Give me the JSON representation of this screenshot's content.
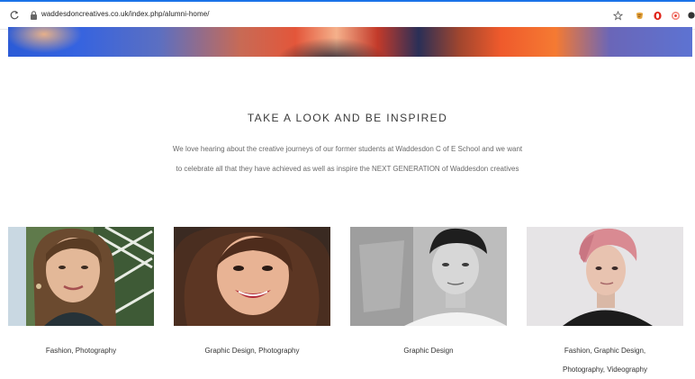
{
  "browser": {
    "url": "waddesdoncreatives.co.uk/index.php/alumni-home/"
  },
  "icons": [
    "reload-icon",
    "lock-icon",
    "star-icon",
    "extension-icon",
    "opera-icon",
    "target-icon"
  ],
  "section": {
    "title": "TAKE A LOOK AND BE INSPIRED",
    "intro_line1": "We love hearing about the creative journeys of our former students at Waddesdon C of E School and we want",
    "intro_line2": "to celebrate all that they have achieved as well as inspire the NEXT GENERATION of Waddesdon creatives"
  },
  "alumni": [
    {
      "caption": "Fashion, Photography"
    },
    {
      "caption": "Graphic Design, Photography"
    },
    {
      "caption": "Graphic Design"
    },
    {
      "caption_line1": "Fashion, Graphic Design,",
      "caption_line2": "Photography, Videography"
    }
  ],
  "colors": {
    "accent": "#1a73e8",
    "title_text": "#3a3a3a",
    "body_text": "#6a6a6a"
  }
}
